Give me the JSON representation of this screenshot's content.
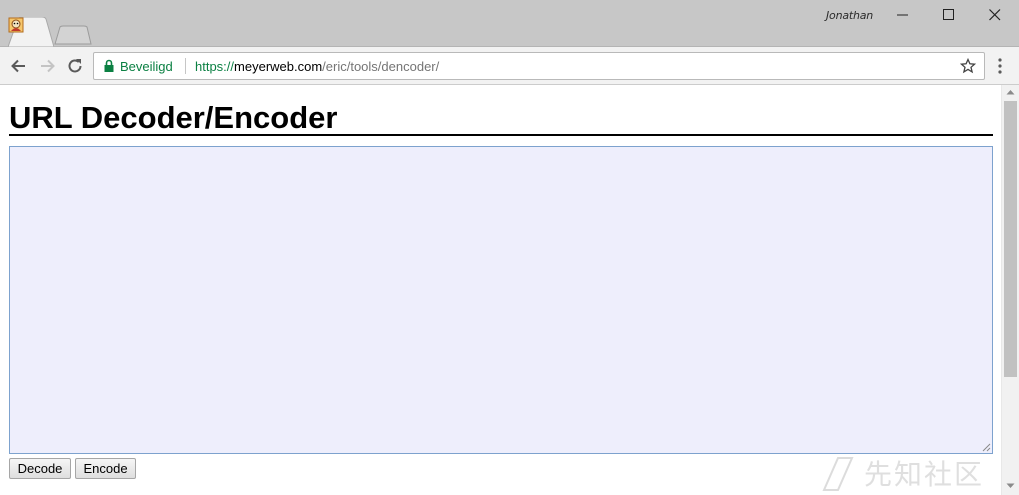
{
  "browser": {
    "profile_name": "Jonathan",
    "security_label": "Beveiligd",
    "url_scheme": "https://",
    "url_host": "meyerweb.com",
    "url_path": "/eric/tools/dencoder/"
  },
  "page": {
    "title": "URL Decoder/Encoder",
    "textarea_value": "",
    "decode_label": "Decode",
    "encode_label": "Encode"
  },
  "watermark": {
    "text": "先知社区"
  },
  "colors": {
    "secure_green": "#0b8043",
    "textarea_bg": "#eeeefc",
    "textarea_border": "#7da2ce"
  }
}
